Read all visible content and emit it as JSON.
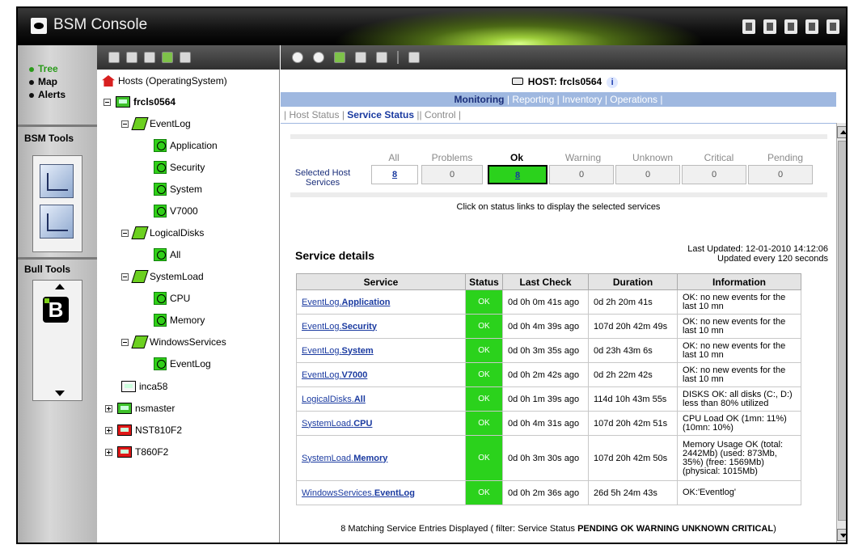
{
  "window": {
    "title": "BSM Console"
  },
  "nav": {
    "links": [
      {
        "label": "Tree",
        "active": true
      },
      {
        "label": "Map"
      },
      {
        "label": "Alerts"
      }
    ],
    "bsm_tools_label": "BSM Tools",
    "bull_tools_label": "Bull Tools"
  },
  "tree": {
    "root": "Hosts (OperatingSystem)",
    "host": "frcls0564",
    "groups": [
      {
        "name": "EventLog",
        "items": [
          "Application",
          "Security",
          "System",
          "V7000"
        ]
      },
      {
        "name": "LogicalDisks",
        "items": [
          "All"
        ]
      },
      {
        "name": "SystemLoad",
        "items": [
          "CPU",
          "Memory"
        ]
      },
      {
        "name": "WindowsServices",
        "items": [
          "EventLog"
        ]
      }
    ],
    "other_hosts": [
      "inca58",
      "nsmaster",
      "NST810F2",
      "T860F2"
    ]
  },
  "main": {
    "host_title": "HOST: frcls0564",
    "info_icon": "i",
    "tabs": [
      "Monitoring",
      "Reporting",
      "Inventory",
      "Operations"
    ],
    "subtabs": [
      "Host Status",
      "Service Status",
      "Control"
    ],
    "summary": {
      "row_label": "Selected Host Services",
      "headers": [
        "All",
        "Problems",
        "Ok",
        "Warning",
        "Unknown",
        "Critical",
        "Pending"
      ],
      "values": [
        "8",
        "0",
        "8",
        "0",
        "0",
        "0",
        "0"
      ]
    },
    "hint": "Click on status links to display the selected services",
    "details_title": "Service details",
    "last_updated": "Last Updated: 12-01-2010 14:12:06",
    "update_interval": "Updated every 120 seconds",
    "table": {
      "headers": [
        "Service",
        "Status",
        "Last Check",
        "Duration",
        "Information"
      ],
      "rows": [
        {
          "prefix": "EventLog.",
          "name": "Application",
          "status": "OK",
          "last_check": "0d 0h 0m 41s ago",
          "duration": "0d 2h 20m 41s",
          "info": "OK: no new events for the last 10 mn"
        },
        {
          "prefix": "EventLog.",
          "name": "Security",
          "status": "OK",
          "last_check": "0d 0h 4m 39s ago",
          "duration": "107d 20h 42m 49s",
          "info": "OK: no new events for the last 10 mn"
        },
        {
          "prefix": "EventLog.",
          "name": "System",
          "status": "OK",
          "last_check": "0d 0h 3m 35s ago",
          "duration": "0d 23h 43m 6s",
          "info": "OK: no new events for the last 10 mn"
        },
        {
          "prefix": "EventLog.",
          "name": "V7000",
          "status": "OK",
          "last_check": "0d 0h 2m 42s ago",
          "duration": "0d 2h 22m 42s",
          "info": "OK: no new events for the last 10 mn"
        },
        {
          "prefix": "LogicalDisks.",
          "name": "All",
          "status": "OK",
          "last_check": "0d 0h 1m 39s ago",
          "duration": "114d 10h 43m 55s",
          "info": "DISKS OK: all disks (C:, D:) less than 80% utilized"
        },
        {
          "prefix": "SystemLoad.",
          "name": "CPU",
          "status": "OK",
          "last_check": "0d 0h 4m 31s ago",
          "duration": "107d 20h 42m 51s",
          "info": "CPU Load OK (1mn: 11%) (10mn: 10%)"
        },
        {
          "prefix": "SystemLoad.",
          "name": "Memory",
          "status": "OK",
          "last_check": "0d 0h 3m 30s ago",
          "duration": "107d 20h 42m 50s",
          "info": "Memory Usage OK (total: 2442Mb) (used: 873Mb, 35%) (free: 1569Mb) (physical: 1015Mb)"
        },
        {
          "prefix": "WindowsServices.",
          "name": "EventLog",
          "status": "OK",
          "last_check": "0d 0h 2m 36s ago",
          "duration": "26d 5h 24m 43s",
          "info": "OK:'Eventlog'"
        }
      ]
    },
    "footer_prefix": "8 Matching Service Entries Displayed ( filter: Service Status ",
    "footer_filter": "PENDING OK WARNING UNKNOWN CRITICAL",
    "footer_suffix": ")"
  },
  "colors": {
    "ok_green": "#2bd21c",
    "tab_blue": "#9fb8e0",
    "link_blue": "#1a3aa0"
  }
}
